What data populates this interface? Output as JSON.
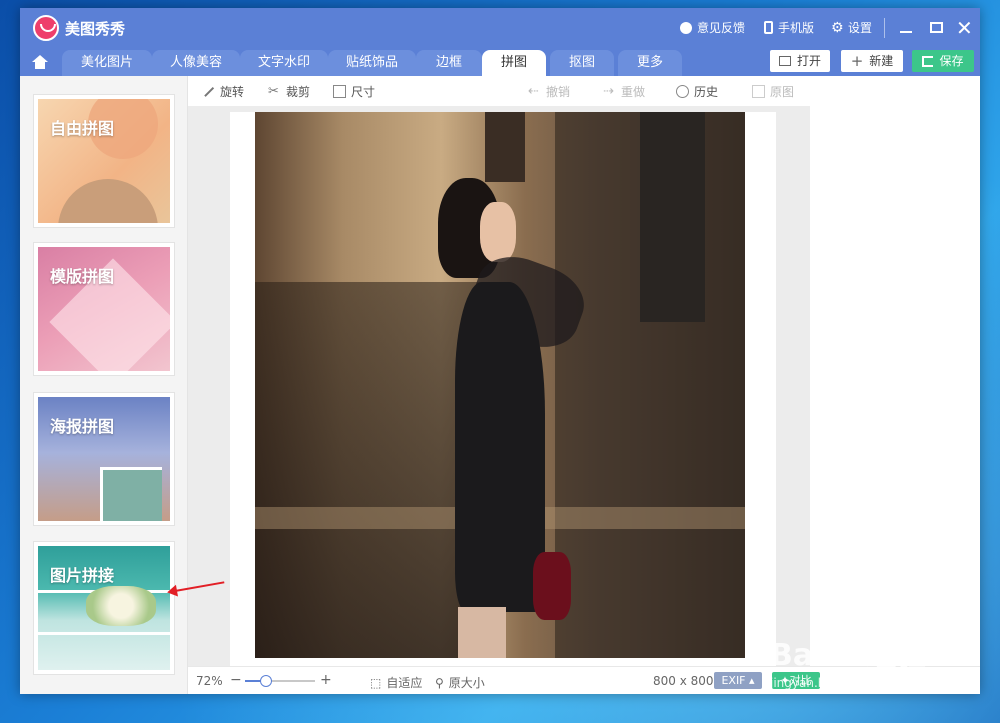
{
  "app": {
    "title": "美图秀秀"
  },
  "titlebar": {
    "feedback_label": "意见反馈",
    "mobile_label": "手机版",
    "settings_label": "设置"
  },
  "tabs": [
    {
      "label": "美化图片",
      "active": false
    },
    {
      "label": "人像美容",
      "active": false
    },
    {
      "label": "文字水印",
      "active": false
    },
    {
      "label": "贴纸饰品",
      "active": false
    },
    {
      "label": "边框",
      "active": false
    },
    {
      "label": "拼图",
      "active": true
    },
    {
      "label": "抠图",
      "active": false
    },
    {
      "label": "更多",
      "active": false
    }
  ],
  "actions": {
    "open_label": "打开",
    "new_label": "新建",
    "save_label": "保存"
  },
  "sidebar": {
    "cards": [
      {
        "label": "自由拼图"
      },
      {
        "label": "模版拼图"
      },
      {
        "label": "海报拼图"
      },
      {
        "label": "图片拼接"
      }
    ]
  },
  "toolbar": {
    "rotate": "旋转",
    "crop": "裁剪",
    "size": "尺寸",
    "undo": "撤销",
    "redo": "重做",
    "history": "历史",
    "original": "原图"
  },
  "status": {
    "zoom": "72%",
    "zoom_minus": "−",
    "zoom_plus": "+",
    "zoom_level": 0.3,
    "fit_label": "自适应",
    "actual_label": "原大小",
    "dimensions": "800 x 800",
    "exif_label": "EXIF ▴",
    "compare_label": "对比"
  },
  "watermark": {
    "main": "Baidu经验",
    "sub": "jingyan.baidu.com"
  },
  "colors": {
    "accent": "#5b80d6",
    "save_green": "#3cc68a",
    "arrow_red": "#e21f26"
  }
}
